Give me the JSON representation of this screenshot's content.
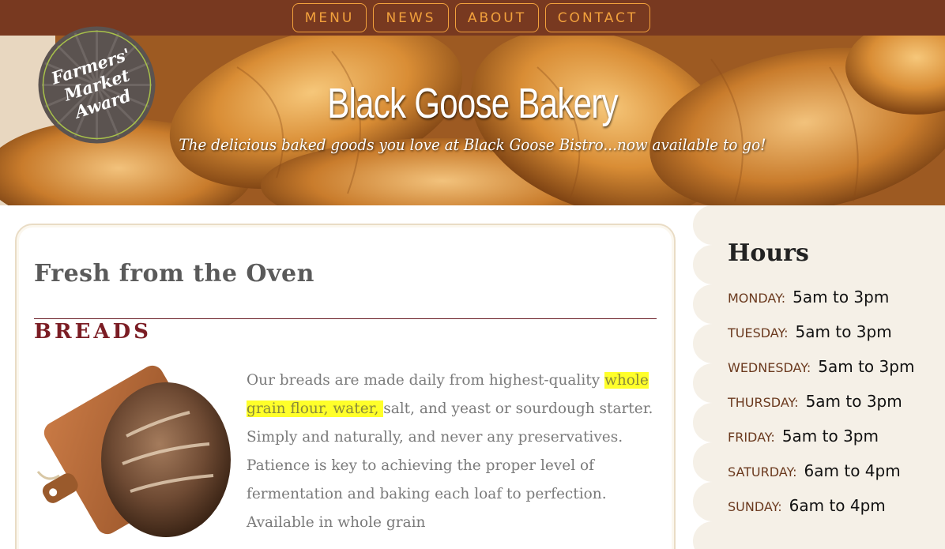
{
  "nav": {
    "items": [
      {
        "label": "MENU"
      },
      {
        "label": "NEWS"
      },
      {
        "label": "ABOUT"
      },
      {
        "label": "CONTACT"
      }
    ]
  },
  "hero": {
    "title": "Black Goose Bakery",
    "subtitle": "The delicious baked goods you love at Black Goose Bistro...now available to go!"
  },
  "badge": {
    "line1": "Farmers'",
    "line2": "Market",
    "line3": "Award"
  },
  "main": {
    "heading": "Fresh from the Oven",
    "section_heading": "BREADS",
    "body_before": "Our breads are made daily from highest-quality ",
    "body_highlight": "whole grain flour, water, ",
    "body_after": "salt, and yeast or sourdough starter. Simply and naturally, and never any preservatives. Patience is key to achieving the proper level of fermentation and baking each loaf to perfection. Available in whole grain"
  },
  "hours": {
    "title": "Hours",
    "rows": [
      {
        "day": "MONDAY:",
        "time": "5am to 3pm"
      },
      {
        "day": "TUESDAY:",
        "time": "5am to 3pm"
      },
      {
        "day": "WEDNESDAY:",
        "time": "5am to 3pm"
      },
      {
        "day": "THURSDAY:",
        "time": "5am to 3pm"
      },
      {
        "day": "FRIDAY:",
        "time": "5am to 3pm"
      },
      {
        "day": "SATURDAY:",
        "time": "6am to 4pm"
      },
      {
        "day": "SUNDAY:",
        "time": "6am to 4pm"
      }
    ]
  },
  "colors": {
    "nav_bg": "#783920",
    "nav_accent": "#f2a13c",
    "breads_heading": "#7b1d24",
    "highlight": "#ffff2a",
    "sidebar_bg": "#f5f0e7"
  }
}
